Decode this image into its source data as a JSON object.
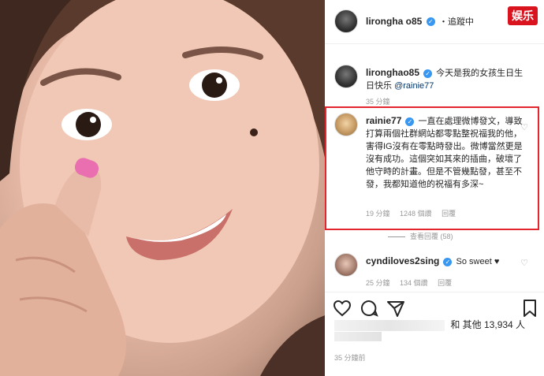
{
  "header": {
    "username": "lirongha o85",
    "follow_label": "・追蹤中",
    "verified_mark": "✓"
  },
  "brand_badge": "娱乐",
  "caption": {
    "username": "lironghao85",
    "verified_mark": "✓",
    "text": "今天是我的女孩生日生日快乐",
    "mention": "@rainie77",
    "time": "35 分鐘"
  },
  "highlighted_comment": {
    "username": "rainie77",
    "verified_mark": "✓",
    "text": "一直在處理微博發文，導致打算兩個社群網站都零點整祝福我的他，害得IG沒有在零點時發出。微博當然更是沒有成功。這個突如其來的插曲，破壞了他守時的計畫。但是不管幾點發，甚至不發，我都知道他的祝福有多深~",
    "time": "19 分鐘",
    "likes": "1248 個讚",
    "reply": "回覆",
    "heart": "♡"
  },
  "view_replies": "查看回覆 (58)",
  "cyndi_comment": {
    "username": "cyndiloves2sing",
    "verified_mark": "✓",
    "text": "So sweet",
    "emoji": "♥",
    "time": "25 分鐘",
    "likes": "134 個讚",
    "reply": "回覆",
    "heart": "♡"
  },
  "likes_suffix": "和 其他 13,934 人",
  "post_time": "35 分鐘前",
  "icons": {
    "like": "heart-outline-icon",
    "comment": "comment-icon",
    "share": "share-icon",
    "save": "bookmark-icon"
  }
}
